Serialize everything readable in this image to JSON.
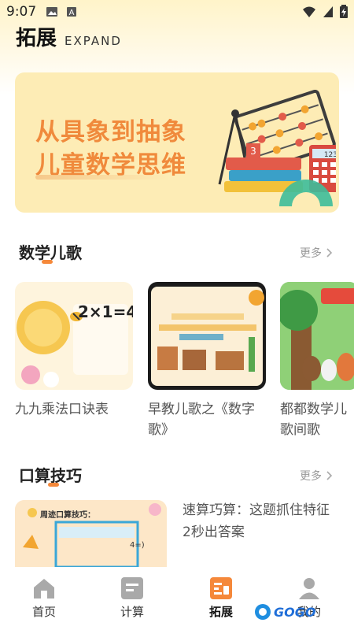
{
  "status_bar": {
    "time": "9:07"
  },
  "header": {
    "title": "拓展",
    "subtitle": "EXPAND"
  },
  "banner": {
    "line1": "从具象到抽象",
    "line2": "儿童数学思维"
  },
  "sections": [
    {
      "title": "数学儿歌",
      "more_label": "更多",
      "cards": [
        {
          "title": "九九乘法口诀表",
          "thumb_text": "2×1=4"
        },
        {
          "title": "早教儿歌之《数字歌》",
          "thumb_text": ""
        },
        {
          "title": "都都数学儿歌间歌",
          "thumb_text": ""
        }
      ]
    },
    {
      "title": "口算技巧",
      "more_label": "更多",
      "items": [
        {
          "title": "速算巧算：这题抓住特征2秒出答案",
          "thumb_text": "周迹口算技巧：",
          "thumb_sub": "4=)"
        }
      ]
    }
  ],
  "bottom_nav": [
    {
      "label": "首页",
      "icon": "home-icon",
      "active": false
    },
    {
      "label": "计算",
      "icon": "calculate-icon",
      "active": false
    },
    {
      "label": "拓展",
      "icon": "expand-icon",
      "active": true
    },
    {
      "label": "我的",
      "icon": "user-icon",
      "active": false
    }
  ],
  "watermark": {
    "text": "GOGO"
  },
  "colors": {
    "accent": "#f5883a",
    "banner_bg": "#fdecb5",
    "banner_text": "#f08a3c"
  }
}
